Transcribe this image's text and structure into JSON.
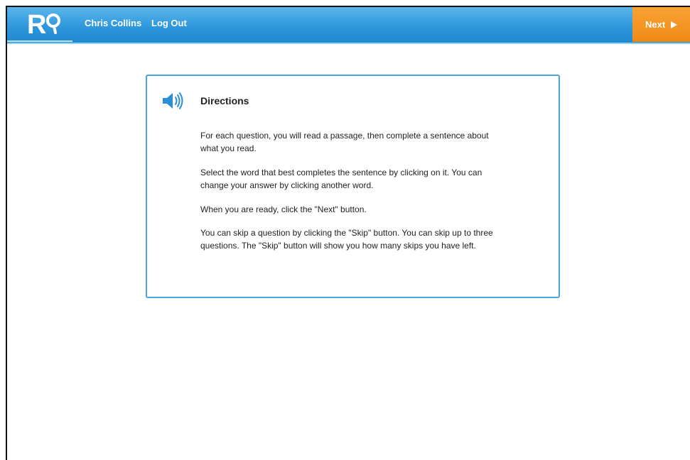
{
  "header": {
    "logo_text": "R",
    "user_name": "Chris Collins",
    "logout_label": "Log Out",
    "next_label": "Next"
  },
  "directions": {
    "title": "Directions",
    "paragraphs": [
      "For each question, you will read a passage, then complete a sentence about what you read.",
      "Select the word that best completes the sentence by clicking on it.  You can change your answer by clicking another word.",
      "When you are ready, click the \"Next\" button.",
      "You can skip a question by clicking the \"Skip\" button.  You can skip up to three questions.  The \"Skip\" button will show you how many skips you have left."
    ]
  },
  "icons": {
    "audio": "speaker-icon",
    "next": "play-arrow-icon",
    "logo": "magnifier-icon"
  },
  "colors": {
    "header_blue": "#2f98dc",
    "next_orange": "#f28a16",
    "card_border": "#4aa3dc",
    "speaker_blue": "#2a8fd6"
  }
}
